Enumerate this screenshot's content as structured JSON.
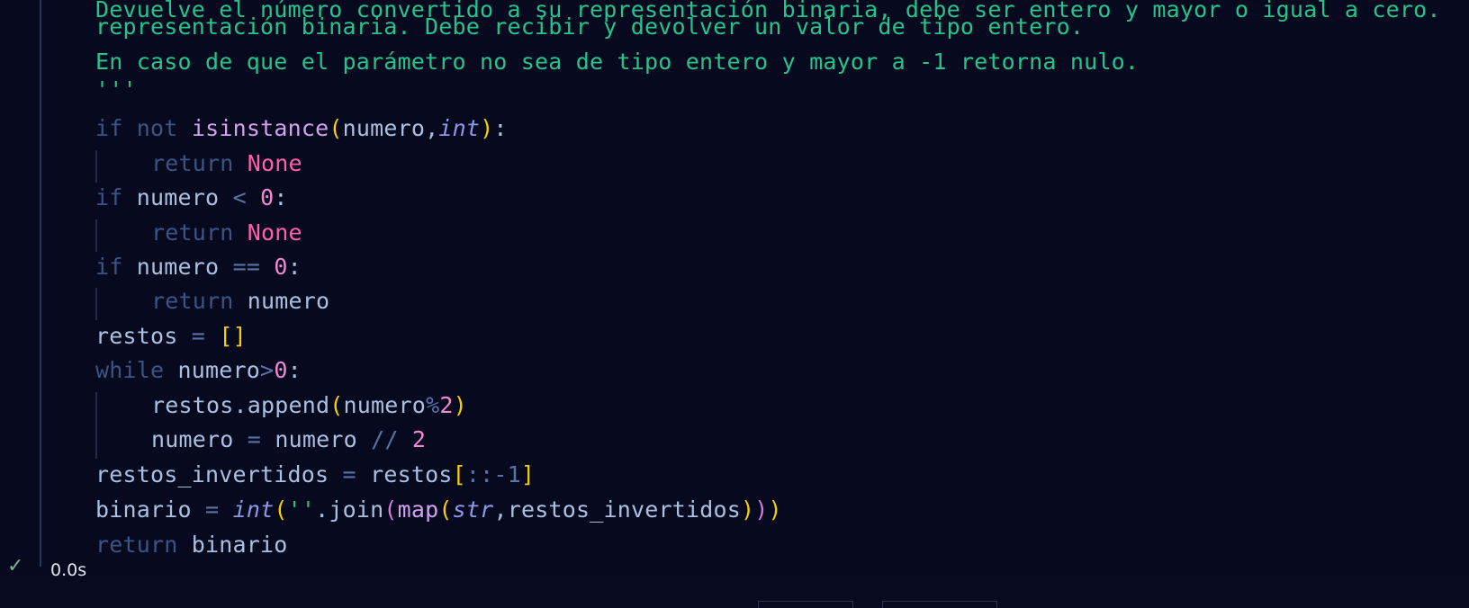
{
  "cell": {
    "docstring_cut_line": "Devuelve el número convertido a su representación binaria, debe ser entero y mayor o igual a cero.",
    "docstring_line_1": "representación binaria. Debe recibir y devolver un valor de tipo entero.",
    "docstring_line_2": "En caso de que el parámetro no sea de tipo entero y mayor a -1 retorna nulo.",
    "docstring_close": "'''",
    "code": {
      "if": "if",
      "not": "not",
      "isinstance": "isinstance",
      "open_paren": "(",
      "close_paren": ")",
      "numero": "numero",
      "comma": ",",
      "int": "int",
      "colon": ":",
      "return": "return",
      "None": "None",
      "lt": "<",
      "eq": "==",
      "zero": "0",
      "restos": "restos",
      "assign": "=",
      "empty_list": "[]",
      "while": "while",
      "gt": ">",
      "append": "restos.append",
      "mod": "%",
      "two": "2",
      "floordiv": "//",
      "restos_invertidos": "restos_invertidos",
      "open_bracket": "[",
      "close_bracket": "]",
      "slice": "::-1",
      "binario": "binario",
      "quote_pair": "''",
      "join": ".join",
      "map": "map",
      "str": "str"
    }
  },
  "status": {
    "check_icon": "check-icon",
    "time": "0.0s",
    "success_color": "#7fb08f"
  },
  "colors": {
    "background": "#07091e",
    "string": "#24c48c",
    "keyword": "#3a5585",
    "function": "#d3a2ec",
    "variable": "#a9c1df",
    "bracket": "#f5d000",
    "number": "#f08ad0",
    "none": "#ff5fae",
    "builtin": "#8e99e6"
  }
}
